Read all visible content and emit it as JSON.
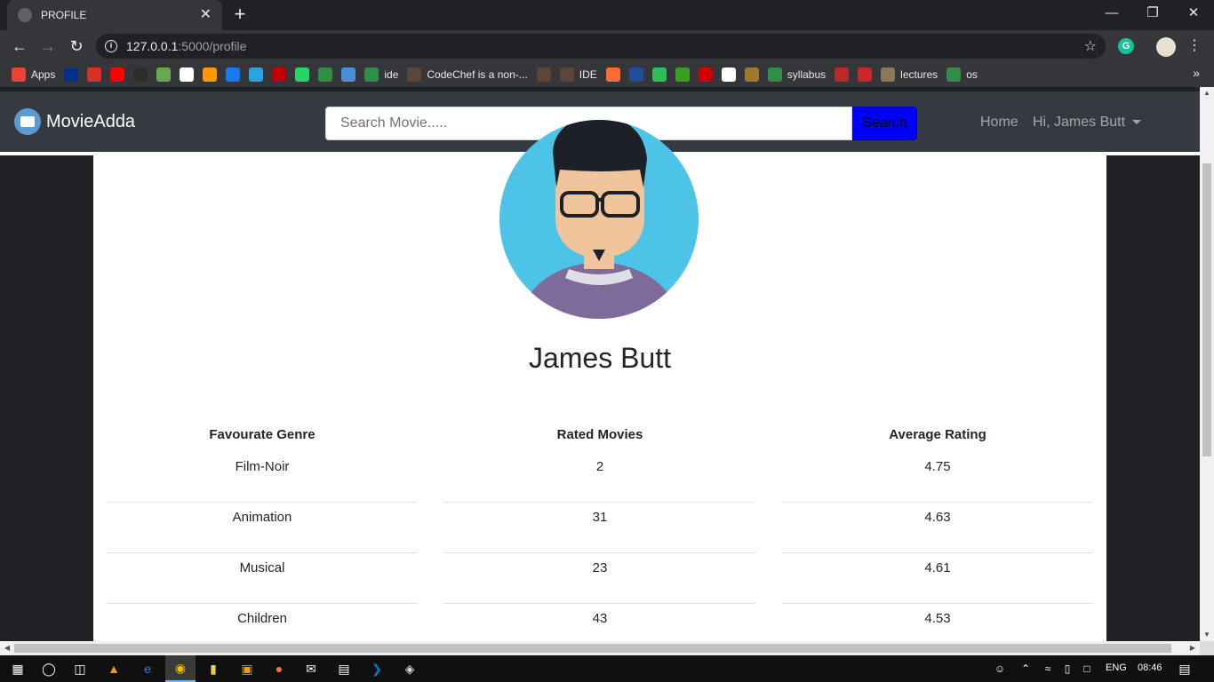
{
  "browser": {
    "tab_title": "PROFILE",
    "url_host": "127.0.0.1",
    "url_path": ":5000/profile",
    "bookmarks": [
      {
        "label": "Apps",
        "icon": "apps-grid-icon",
        "color": "#ea4335"
      },
      {
        "label": "",
        "icon": "paypal-icon",
        "color": "#003087"
      },
      {
        "label": "",
        "icon": "gmail-icon",
        "color": "#d93025"
      },
      {
        "label": "",
        "icon": "youtube-icon",
        "color": "#ff0000"
      },
      {
        "label": "",
        "icon": "bookmark-icon",
        "color": "#2d2d2d"
      },
      {
        "label": "",
        "icon": "play-icon",
        "color": "#6aa84f"
      },
      {
        "label": "",
        "icon": "amazon-icon",
        "color": "#ffffff"
      },
      {
        "label": "",
        "icon": "bookmark-icon",
        "color": "#ff9900"
      },
      {
        "label": "",
        "icon": "facebook-icon",
        "color": "#1877f2"
      },
      {
        "label": "",
        "icon": "telegram-icon",
        "color": "#2aa3df"
      },
      {
        "label": "",
        "icon": "bookmark-icon",
        "color": "#c00000"
      },
      {
        "label": "",
        "icon": "whatsapp-icon",
        "color": "#25d366"
      },
      {
        "label": "",
        "icon": "gfg-icon",
        "color": "#2f8d46"
      },
      {
        "label": "",
        "icon": "link-icon",
        "color": "#4a90d9"
      },
      {
        "label": "ide",
        "icon": "gfg-icon",
        "color": "#2f8d46"
      },
      {
        "label": "CodeChef is a non-...",
        "icon": "codechef-icon",
        "color": "#5b4638"
      },
      {
        "label": "",
        "icon": "codechef-icon",
        "color": "#5b4638"
      },
      {
        "label": "IDE",
        "icon": "codechef-icon",
        "color": "#5b4638"
      },
      {
        "label": "",
        "icon": "bookmark-icon",
        "color": "#ff6b35"
      },
      {
        "label": "",
        "icon": "bookmark-icon",
        "color": "#1f4e9c"
      },
      {
        "label": "",
        "icon": "bookmark-icon",
        "color": "#2ebd59"
      },
      {
        "label": "",
        "icon": "bookmark-icon",
        "color": "#3a9d23"
      },
      {
        "label": "",
        "icon": "bookmark-icon",
        "color": "#d00000"
      },
      {
        "label": "",
        "icon": "bookmark-icon",
        "color": "#ffffff"
      },
      {
        "label": "",
        "icon": "bookmark-icon",
        "color": "#9c7b29"
      },
      {
        "label": "syllabus",
        "icon": "gfg-icon",
        "color": "#2f8d46"
      },
      {
        "label": "",
        "icon": "quora-icon",
        "color": "#b92b27"
      },
      {
        "label": "",
        "icon": "bookmark-icon",
        "color": "#c62828"
      },
      {
        "label": "lectures",
        "icon": "bookmark-icon",
        "color": "#8a7a5a"
      },
      {
        "label": "os",
        "icon": "gfg-icon",
        "color": "#2f8d46"
      }
    ]
  },
  "navbar": {
    "brand": "MovieAdda",
    "search_placeholder": "Search Movie.....",
    "search_button": "Search",
    "home_link": "Home",
    "user_menu": "Hi, James Butt"
  },
  "profile": {
    "name": "James Butt",
    "columns": [
      {
        "header": "Favourate Genre",
        "values": [
          "Film-Noir",
          "Animation",
          "Musical",
          "Children"
        ]
      },
      {
        "header": "Rated Movies",
        "values": [
          "2",
          "31",
          "23",
          "43"
        ]
      },
      {
        "header": "Average Rating",
        "values": [
          "4.75",
          "4.63",
          "4.61",
          "4.53"
        ]
      }
    ]
  },
  "taskbar": {
    "language": "ENG",
    "time": "08:46"
  },
  "colors": {
    "navbar_bg": "#343a40",
    "search_button_bg": "#0000ff",
    "avatar_bg": "#4ec3e8"
  }
}
